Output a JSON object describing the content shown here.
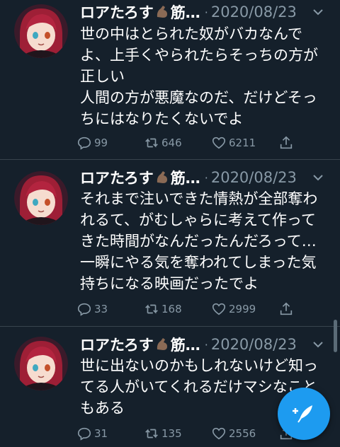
{
  "tweets": [
    {
      "name": "ロアたろす",
      "name_suffix": "筋…",
      "date": "2020/08/23",
      "text": "世の中はとられた奴がバカなんで\nよ、上手くやられたらそっちの方が\n正しい\n人間の方が悪魔なのだ、だけどそっ\nちにはなりたくないでよ",
      "replies": "99",
      "retweets": "646",
      "likes": "6211"
    },
    {
      "name": "ロアたろす",
      "name_suffix": "筋…",
      "date": "2020/08/23",
      "text": "それまで注いできた情熱が全部奪わ\nれるて、がむしゃらに考えて作って\nきた時間がなんだったんだろって…\n一瞬にやる気を奪われてしまった気\n持ちになる映画だったでよ",
      "replies": "33",
      "retweets": "168",
      "likes": "2999"
    },
    {
      "name": "ロアたろす",
      "name_suffix": "筋…",
      "date": "2020/08/23",
      "text": "世に出ないのかもしれないけど知っ\nてる人がいてくれるだけマシなこと\nもある",
      "replies": "31",
      "retweets": "135",
      "likes": "2556"
    }
  ],
  "icons": {
    "reply": "reply-icon",
    "retweet": "retweet-icon",
    "like": "like-icon",
    "share": "share-icon",
    "compose": "compose-tweet-icon",
    "caret": "chevron-down-icon"
  },
  "colors": {
    "background": "#15202b",
    "secondary_text": "#8899a6",
    "accent": "#1d9bf0",
    "divider": "#38444d"
  }
}
